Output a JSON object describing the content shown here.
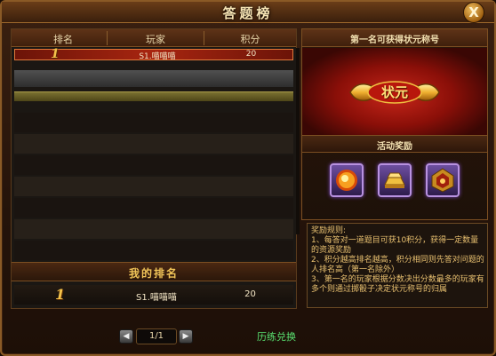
{
  "window": {
    "title": "答题榜",
    "close_label": "X"
  },
  "table": {
    "columns": [
      "排名",
      "玩家",
      "积分"
    ],
    "rows": [
      {
        "rank": "1",
        "player": "S1.喵喵喵",
        "score": "20"
      }
    ]
  },
  "my_rank": {
    "title": "我的排名",
    "rank": "1",
    "player": "S1.喵喵喵",
    "score": "20"
  },
  "pager": {
    "current": "1/1",
    "prev_label": "◀",
    "next_label": "▶"
  },
  "history_link": "历练兑换",
  "right_panel": {
    "header": "第一名可获得状元称号",
    "badge_text": "状元",
    "rewards_header": "活动奖励",
    "rewards": [
      {
        "icon": "fire-orb-icon"
      },
      {
        "icon": "gold-ingot-icon"
      },
      {
        "icon": "gem-emblem-icon"
      }
    ]
  },
  "rules": {
    "title": "奖励规则:",
    "lines": [
      "1、每答对一道题目可获10积分，获得一定数量的资源奖励",
      "2、积分越高排名越高，积分相同则先答对问题的人排名高（第一名除外）",
      "3、第一名的玩家根据分数决出分数最多的玩家有多个则通过掷骰子决定状元称号的归属"
    ]
  },
  "colors": {
    "accent": "#f0c458",
    "link": "#59e070",
    "first_row": "#a82510"
  }
}
